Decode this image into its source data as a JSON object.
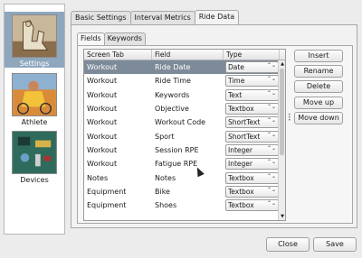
{
  "nav": {
    "items": [
      {
        "label": "Settings",
        "selected": true
      },
      {
        "label": "Athlete",
        "selected": false
      },
      {
        "label": "Devices",
        "selected": false
      }
    ]
  },
  "tabs": [
    {
      "label": "Basic Settings",
      "active": false
    },
    {
      "label": "Interval Metrics",
      "active": false
    },
    {
      "label": "Ride Data",
      "active": true
    }
  ],
  "subtabs": [
    {
      "label": "Fields",
      "active": true
    },
    {
      "label": "Keywords",
      "active": false
    }
  ],
  "table": {
    "headers": [
      "Screen Tab",
      "Field",
      "Type"
    ],
    "rows": [
      {
        "tab": "Workout",
        "field": "Ride Date",
        "type": "Date",
        "selected": true
      },
      {
        "tab": "Workout",
        "field": "Ride Time",
        "type": "Time",
        "selected": false
      },
      {
        "tab": "Workout",
        "field": "Keywords",
        "type": "Text",
        "selected": false
      },
      {
        "tab": "Workout",
        "field": "Objective",
        "type": "Textbox",
        "selected": false
      },
      {
        "tab": "Workout",
        "field": "Workout Code",
        "type": "ShortText",
        "selected": false
      },
      {
        "tab": "Workout",
        "field": "Sport",
        "type": "ShortText",
        "selected": false
      },
      {
        "tab": "Workout",
        "field": "Session RPE",
        "type": "Integer",
        "selected": false
      },
      {
        "tab": "Workout",
        "field": "Fatigue RPE",
        "type": "Integer",
        "selected": false
      },
      {
        "tab": "Notes",
        "field": "Notes",
        "type": "Textbox",
        "selected": false
      },
      {
        "tab": "Equipment",
        "field": "Bike",
        "type": "Textbox",
        "selected": false
      },
      {
        "tab": "Equipment",
        "field": "Shoes",
        "type": "Textbox",
        "selected": false
      }
    ]
  },
  "side_buttons": {
    "insert": "Insert",
    "rename": "Rename",
    "delete": "Delete",
    "move_up": "Move up",
    "move_down": "Move down"
  },
  "footer": {
    "close": "Close",
    "save": "Save"
  },
  "colors": {
    "selection": "#7d8a99",
    "nav_selected": "#8fa7bd"
  },
  "icons": {
    "combo_arrow": "up-down-chevron-icon"
  }
}
